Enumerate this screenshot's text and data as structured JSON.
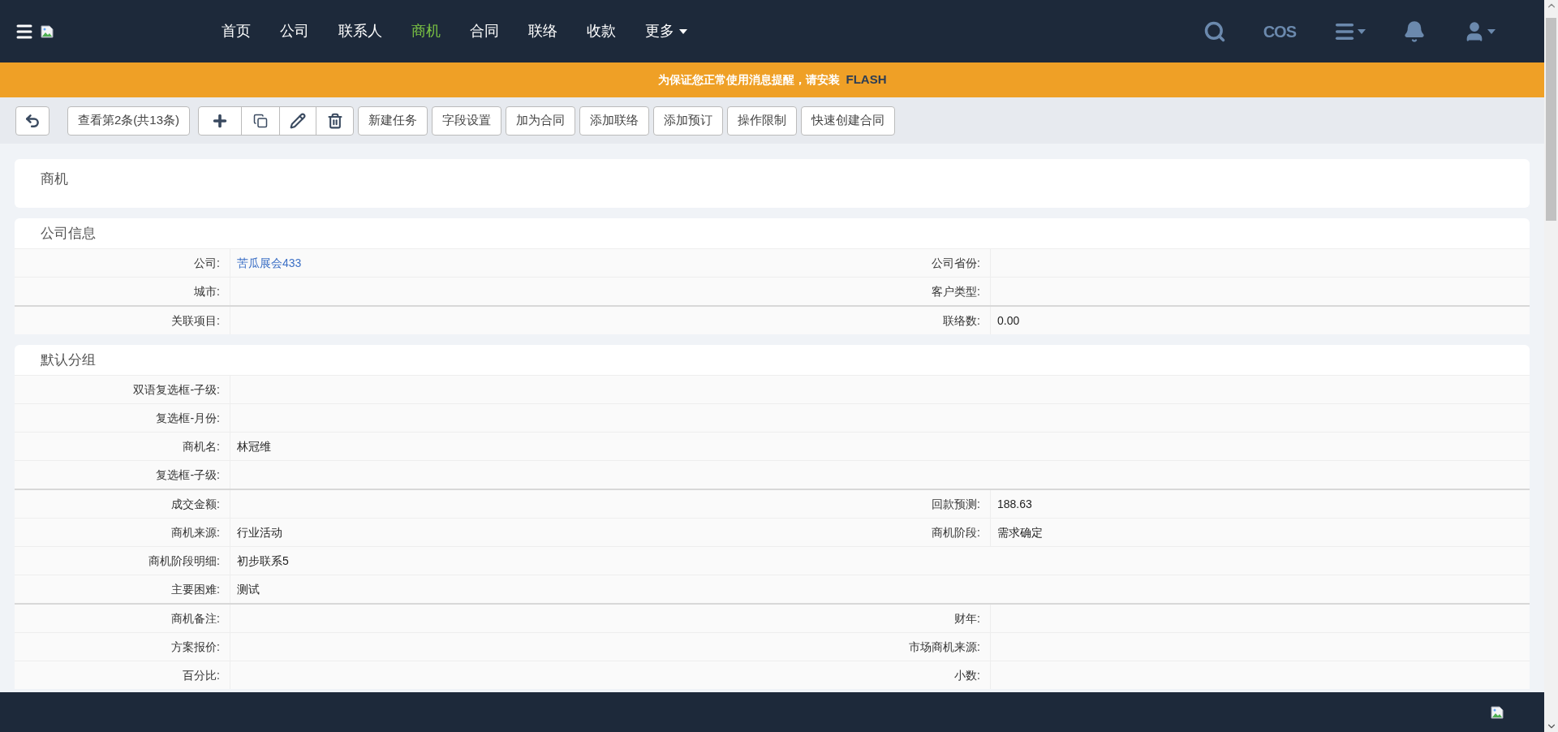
{
  "nav": {
    "items": [
      {
        "label": "首页",
        "selected": false
      },
      {
        "label": "公司",
        "selected": false
      },
      {
        "label": "联系人",
        "selected": false
      },
      {
        "label": "商机",
        "selected": true
      },
      {
        "label": "合同",
        "selected": false
      },
      {
        "label": "联络",
        "selected": false
      },
      {
        "label": "收款",
        "selected": false
      },
      {
        "label": "更多",
        "selected": false,
        "dropdown": true
      }
    ],
    "cos": "COS"
  },
  "notice": {
    "text": "为保证您正常使用消息提醒，请安装",
    "strong": "FLASH"
  },
  "toolbar": {
    "record": "查看第2条(共13条)",
    "buttons": [
      "新建任务",
      "字段设置",
      "加为合同",
      "添加联络",
      "添加预订",
      "操作限制",
      "快速创建合同"
    ]
  },
  "title": "商机",
  "sections": [
    {
      "title": "公司信息",
      "rows": [
        {
          "cells": [
            {
              "label": "公司:",
              "value": "苦瓜展会433",
              "kind": "link"
            },
            {
              "label": "公司省份:"
            }
          ]
        },
        {
          "cells": [
            {
              "label": "城市:"
            },
            {
              "label": "客户类型:"
            }
          ]
        },
        {
          "cells": [
            {
              "label": "关联项目:"
            },
            {
              "label": "联络数:",
              "value": "0.00"
            }
          ],
          "group_start": true
        }
      ]
    },
    {
      "title": "默认分组",
      "rows": [
        {
          "cells": [
            {
              "label": "双语复选框-子级:"
            }
          ]
        },
        {
          "cells": [
            {
              "label": "复选框-月份:"
            }
          ]
        },
        {
          "cells": [
            {
              "label": "商机名:",
              "value": "林冠维"
            }
          ]
        },
        {
          "cells": [
            {
              "label": "复选框-子级:"
            }
          ]
        },
        {
          "cells": [
            {
              "label": "成交金额:"
            },
            {
              "label": "回款预测:",
              "value": "188.63"
            }
          ],
          "group_start": true
        },
        {
          "cells": [
            {
              "label": "商机来源:",
              "value": "行业活动"
            },
            {
              "label": "商机阶段:",
              "value": "需求确定"
            }
          ]
        },
        {
          "cells": [
            {
              "label": "商机阶段明细:",
              "value": "初步联系5"
            }
          ]
        },
        {
          "cells": [
            {
              "label": "主要困难:",
              "value": "测试"
            }
          ]
        },
        {
          "cells": [
            {
              "label": "商机备注:"
            },
            {
              "label": "财年:"
            }
          ],
          "group_start": true
        },
        {
          "cells": [
            {
              "label": "方案报价:"
            },
            {
              "label": "市场商机来源:"
            }
          ]
        },
        {
          "cells": [
            {
              "label": "百分比:"
            },
            {
              "label": "小数:"
            }
          ]
        }
      ]
    }
  ]
}
